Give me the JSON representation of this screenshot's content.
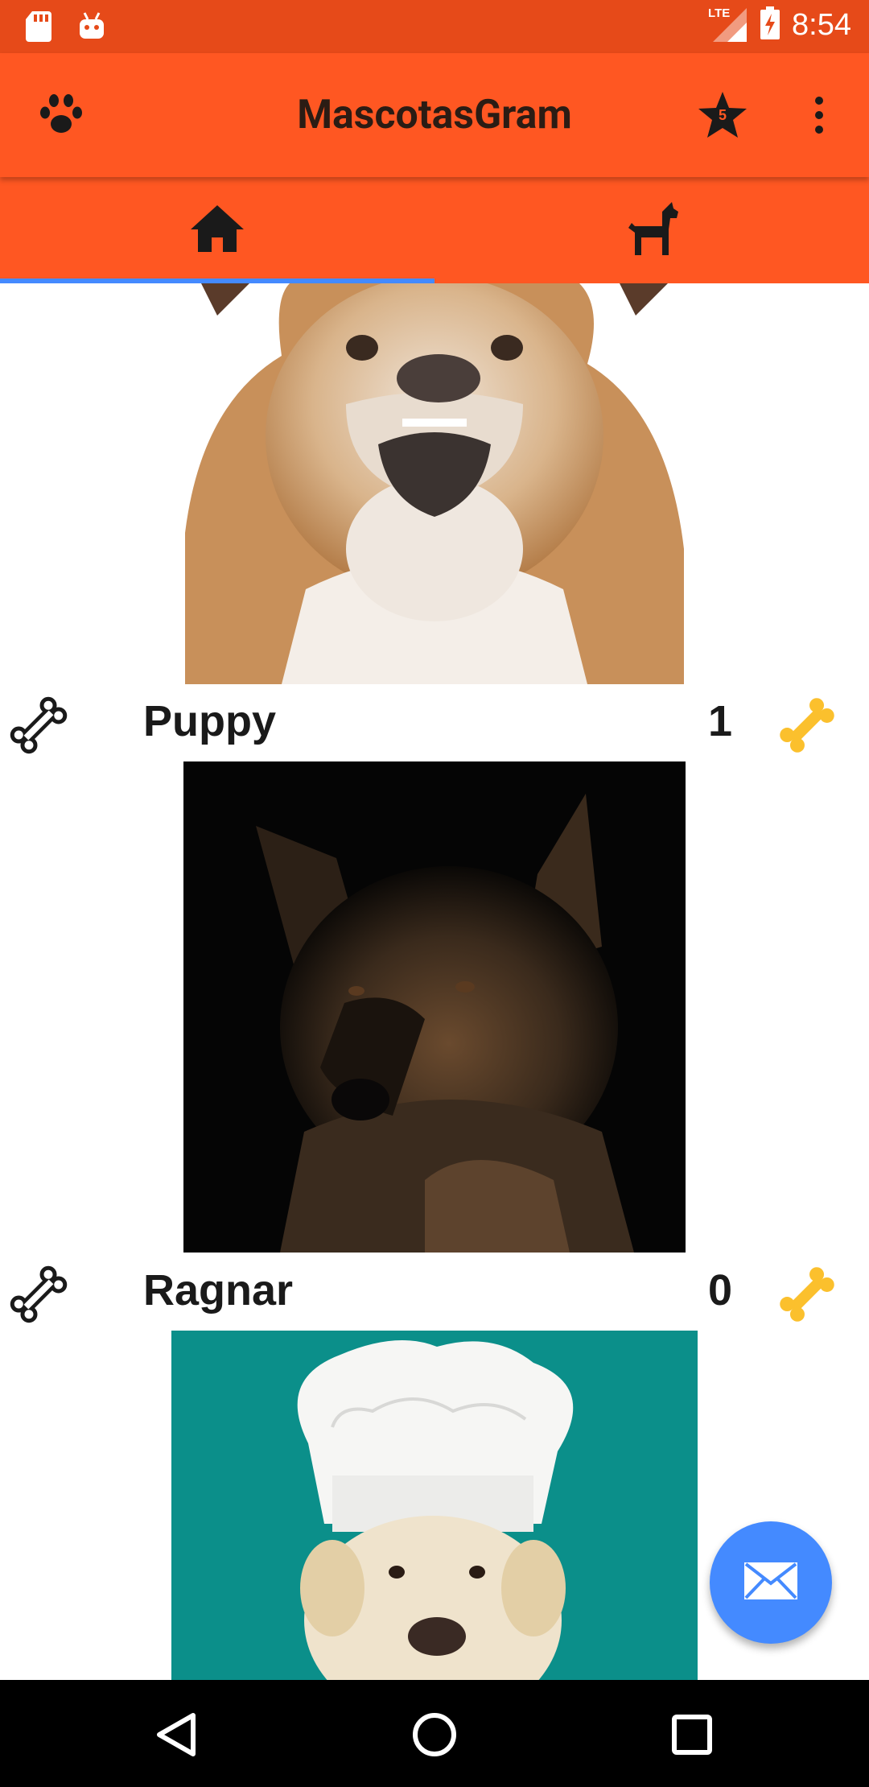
{
  "status_bar": {
    "time": "8:54",
    "network": "LTE",
    "icons": [
      "sd-card-icon",
      "android-icon",
      "lte-signal-icon",
      "battery-charging-icon"
    ]
  },
  "app_bar": {
    "title": "MascotasGram",
    "favorites_badge": "5",
    "icons": [
      "paw-icon",
      "star-icon",
      "more-vert-icon"
    ]
  },
  "tabs": [
    {
      "name": "home",
      "icon": "home-icon",
      "selected": true
    },
    {
      "name": "dog",
      "icon": "dog-icon",
      "selected": false
    }
  ],
  "pets": [
    {
      "name": "Puppy",
      "likes": "1"
    },
    {
      "name": "Ragnar",
      "likes": "0"
    }
  ],
  "colors": {
    "primary": "#ff5722",
    "primary_dark": "#e64a19",
    "accent": "#448aff",
    "bone_yellow": "#fbc02d"
  },
  "fab": {
    "icon": "email-icon"
  },
  "nav_bar": {
    "icons": [
      "back-icon",
      "home-circle-icon",
      "recents-icon"
    ]
  }
}
